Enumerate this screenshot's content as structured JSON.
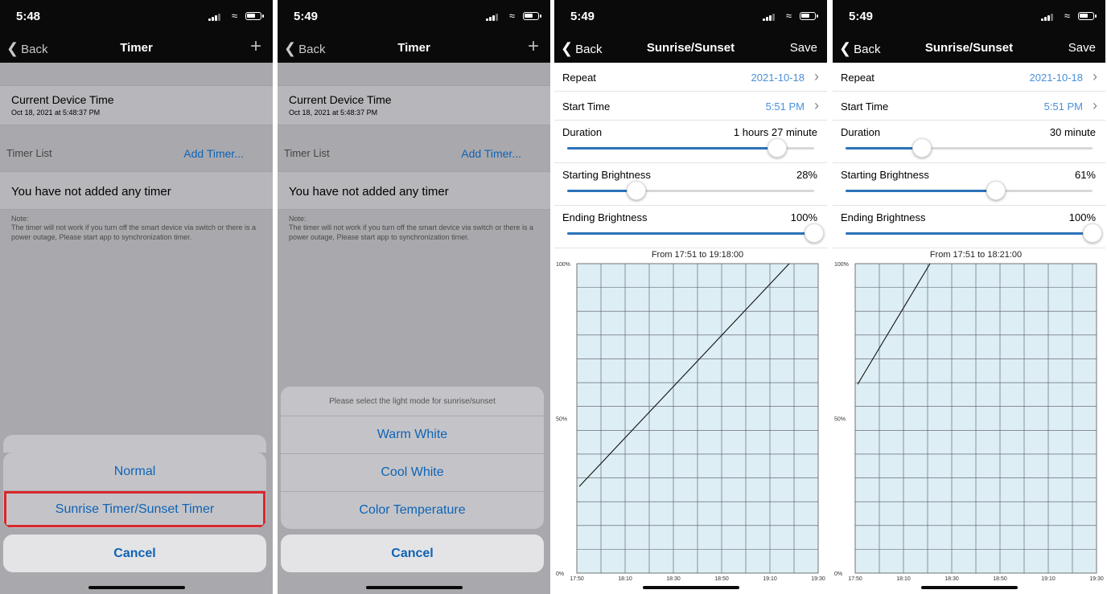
{
  "screens": [
    {
      "status_time": "5:48",
      "nav": {
        "back": "Back",
        "title": "Timer",
        "action": "+"
      },
      "current_device_time_label": "Current Device Time",
      "current_device_time_value": "Oct 18, 2021 at 5:48:37 PM",
      "timer_list_label": "Timer List",
      "add_timer_label": "Add Timer...",
      "empty_text": "You have not added any timer",
      "note": "Note:\nThe timer will not work if you turn off the smart device via switch or there is a power outage, Please start app to synchronization timer.",
      "sheet_options": [
        "Normal",
        "Sunrise Timer/Sunset Timer"
      ],
      "cancel_label": "Cancel"
    },
    {
      "status_time": "5:49",
      "nav": {
        "back": "Back",
        "title": "Timer",
        "action": "+"
      },
      "current_device_time_label": "Current Device Time",
      "current_device_time_value": "Oct 18, 2021 at 5:48:37 PM",
      "timer_list_label": "Timer List",
      "add_timer_label": "Add Timer...",
      "empty_text": "You have not added any timer",
      "note": "Note:\nThe timer will not work if you turn off the smart device via switch or there is a power outage, Please start app to synchronization timer.",
      "sheet_header": "Please select the light mode for sunrise/sunset",
      "sheet_options": [
        "Warm White",
        "Cool White",
        "Color Temperature"
      ],
      "cancel_label": "Cancel"
    },
    {
      "status_time": "5:49",
      "nav": {
        "back": "Back",
        "title": "Sunrise/Sunset",
        "action": "Save"
      },
      "repeat_label": "Repeat",
      "repeat_value": "2021-10-18",
      "start_time_label": "Start Time",
      "start_time_value": "5:51 PM",
      "duration_label": "Duration",
      "duration_value": "1 hours 27 minute",
      "duration_slider": 0.85,
      "start_brightness_label": "Starting Brightness",
      "start_brightness_value": "28%",
      "start_brightness_slider": 0.28,
      "end_brightness_label": "Ending Brightness",
      "end_brightness_value": "100%",
      "end_brightness_slider": 1.0
    },
    {
      "status_time": "5:49",
      "nav": {
        "back": "Back",
        "title": "Sunrise/Sunset",
        "action": "Save"
      },
      "repeat_label": "Repeat",
      "repeat_value": "2021-10-18",
      "start_time_label": "Start Time",
      "start_time_value": "5:51 PM",
      "duration_label": "Duration",
      "duration_value": "30 minute",
      "duration_slider": 0.31,
      "start_brightness_label": "Starting Brightness",
      "start_brightness_value": "61%",
      "start_brightness_slider": 0.61,
      "end_brightness_label": "Ending Brightness",
      "end_brightness_value": "100%",
      "end_brightness_slider": 1.0
    }
  ],
  "chart_data": [
    {
      "type": "line",
      "title": "From 17:51 to 19:18:00",
      "x_ticks": [
        "17:50",
        "18:10",
        "18:30",
        "18:50",
        "19:10",
        "19:30"
      ],
      "y_ticks": [
        "0%",
        "50%",
        "100%"
      ],
      "ylim": [
        0,
        100
      ],
      "xlim": [
        "17:50",
        "19:30"
      ],
      "grid": true,
      "points": [
        {
          "x": "17:51",
          "y": 28
        },
        {
          "x": "19:18",
          "y": 100
        }
      ]
    },
    {
      "type": "line",
      "title": "From 17:51 to 18:21:00",
      "x_ticks": [
        "17:50",
        "18:10",
        "18:30",
        "18:50",
        "19:10",
        "19:30"
      ],
      "y_ticks": [
        "0%",
        "50%",
        "100%"
      ],
      "ylim": [
        0,
        100
      ],
      "xlim": [
        "17:50",
        "19:30"
      ],
      "grid": true,
      "points": [
        {
          "x": "17:51",
          "y": 61
        },
        {
          "x": "18:21",
          "y": 100
        }
      ]
    }
  ],
  "colors": {
    "accent": "#0f63b6",
    "value_blue": "#4a90d9",
    "slider_fill": "#2a72b8",
    "chart_bg": "#ddeef4",
    "highlight": "#d8282c"
  }
}
